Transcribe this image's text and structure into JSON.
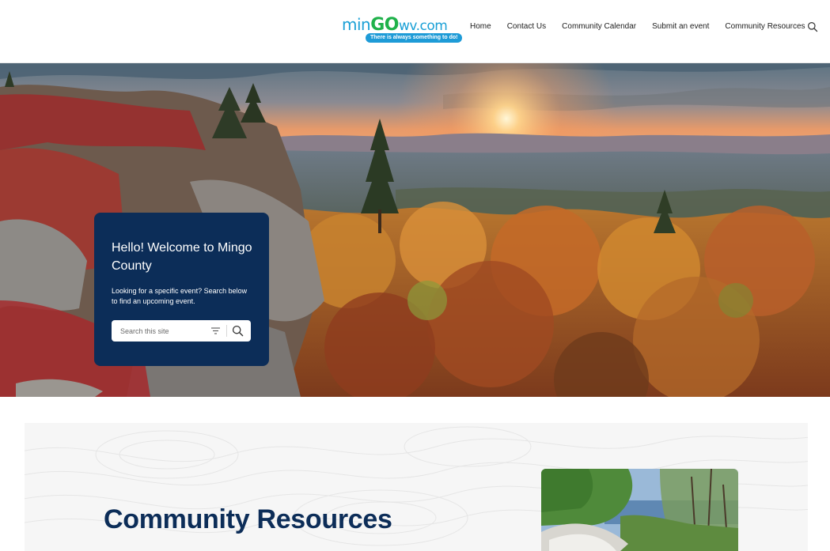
{
  "header": {
    "logo": {
      "part1": "min",
      "part2": "GO",
      "part3": "wv.com",
      "tagline": "There is always something to do!"
    },
    "nav": [
      {
        "label": "Home"
      },
      {
        "label": "Contact Us"
      },
      {
        "label": "Community Calendar"
      },
      {
        "label": "Submit an event"
      },
      {
        "label": "Community Resources"
      }
    ],
    "search_icon": "search-icon"
  },
  "hero": {
    "card": {
      "title": "Hello! Welcome to Mingo County",
      "subtitle": "Looking for a specific event? Search below to find an upcoming event.",
      "search_placeholder": "Search this site",
      "filter_icon": "filter-icon",
      "search_icon": "search-icon"
    }
  },
  "resources": {
    "title": "Community Resources"
  },
  "colors": {
    "navy": "#0c2d58",
    "logo_blue": "#1aa0d6",
    "logo_green": "#1fb14a",
    "section_bg": "#f6f6f6"
  }
}
